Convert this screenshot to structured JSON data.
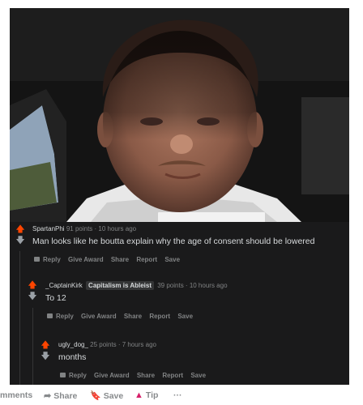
{
  "comments": [
    {
      "username": "SpartanPhi",
      "meta": "91 points · 10 hours ago",
      "flair": "",
      "body": "Man looks like he boutta explain why the age of consent should be lowered",
      "actions": [
        "Reply",
        "Give Award",
        "Share",
        "Report",
        "Save"
      ]
    },
    {
      "username": "_CaptainKirk",
      "flair": "Capitalism is Ableist",
      "meta": "39 points · 10 hours ago",
      "body": "To 12",
      "actions": [
        "Reply",
        "Give Award",
        "Share",
        "Report",
        "Save"
      ]
    },
    {
      "username": "ugly_dog_",
      "flair": "",
      "meta": "25 points · 7 hours ago",
      "body": "months",
      "actions": [
        "Reply",
        "Give Award",
        "Share",
        "Report",
        "Save"
      ]
    }
  ],
  "bottom_bar": {
    "comments_label": "mments",
    "share_label": "Share",
    "save_label": "Save",
    "tip_label": "Tip",
    "more_label": "···"
  },
  "colors": {
    "upvote": "#ff4500",
    "background": "#1a1a1b",
    "text": "#d7dadc",
    "muted": "#818384"
  },
  "icons": [
    "upvote-arrow-icon",
    "downvote-arrow-icon",
    "comment-bubble-icon",
    "share-arrow-icon",
    "bookmark-icon",
    "tip-triangle-icon",
    "more-dots-icon"
  ]
}
